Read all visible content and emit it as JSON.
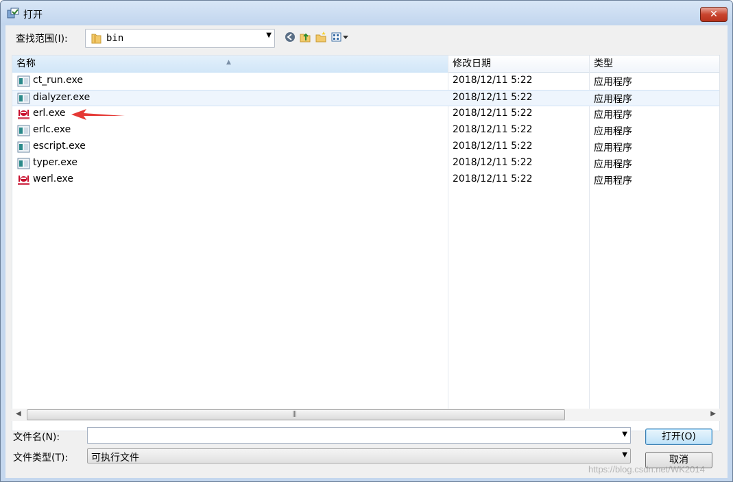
{
  "window": {
    "title": "打开",
    "close_label": "✕"
  },
  "toolbar": {
    "lookin_label": "查找范围(I):",
    "lookin_value": "bin",
    "buttons": [
      "back-icon",
      "up-folder-icon",
      "new-folder-icon",
      "view-menu-icon"
    ]
  },
  "list": {
    "columns": [
      "名称",
      "修改日期",
      "类型"
    ],
    "rows": [
      {
        "name": "ct_run.exe",
        "date": "2018/12/11 5:22",
        "type": "应用程序",
        "icon": "app-icon"
      },
      {
        "name": "dialyzer.exe",
        "date": "2018/12/11 5:22",
        "type": "应用程序",
        "icon": "app-icon"
      },
      {
        "name": "erl.exe",
        "date": "2018/12/11 5:22",
        "type": "应用程序",
        "icon": "erlang-icon"
      },
      {
        "name": "erlc.exe",
        "date": "2018/12/11 5:22",
        "type": "应用程序",
        "icon": "app-icon"
      },
      {
        "name": "escript.exe",
        "date": "2018/12/11 5:22",
        "type": "应用程序",
        "icon": "app-icon"
      },
      {
        "name": "typer.exe",
        "date": "2018/12/11 5:22",
        "type": "应用程序",
        "icon": "app-icon"
      },
      {
        "name": "werl.exe",
        "date": "2018/12/11 5:22",
        "type": "应用程序",
        "icon": "erlang-icon"
      }
    ]
  },
  "footer": {
    "filename_label": "文件名(N):",
    "filename_value": "",
    "filetype_label": "文件类型(T):",
    "filetype_value": "可执行文件",
    "open_label": "打开(O)",
    "cancel_label": "取消"
  },
  "watermark": "https://blog.csdn.net/WK2014",
  "colors": {
    "accent": "#3c7fb1",
    "arrow": "#e53935",
    "close": "#c9452f"
  }
}
